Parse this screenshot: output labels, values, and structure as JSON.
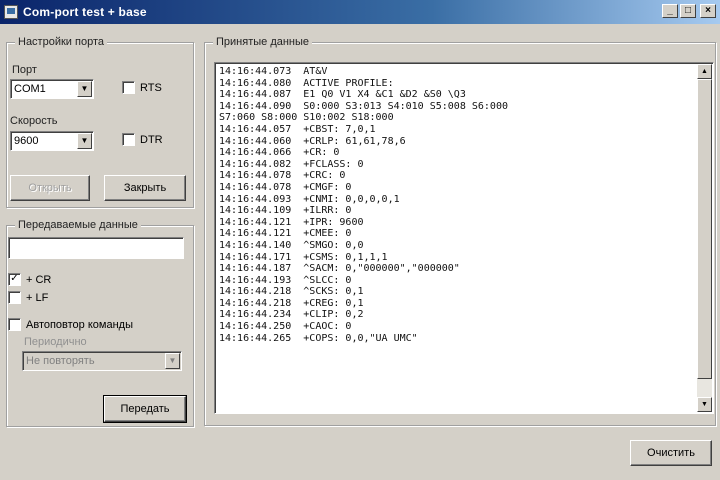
{
  "window": {
    "title": "Com-port test + base",
    "minimize": "_",
    "maximize": "□",
    "close": "×"
  },
  "port_settings": {
    "group_label": "Настройки порта",
    "port_label": "Порт",
    "port_value": "COM1",
    "rts_label": "RTS",
    "speed_label": "Скорость",
    "speed_value": "9600",
    "dtr_label": "DTR",
    "open_button": "Открыть",
    "close_button": "Закрыть"
  },
  "send": {
    "group_label": "Передаваемые данные",
    "input_value": "",
    "cr_label": "+ CR",
    "cr_checked": true,
    "lf_label": "+ LF",
    "lf_checked": false,
    "auto_label": "Автоповтор команды",
    "auto_checked": false,
    "period_label": "Периодично",
    "period_value": "Не повторять",
    "send_button": "Передать"
  },
  "received": {
    "group_label": "Принятые данные",
    "lines": [
      "14:16:44.073  AT&V",
      "14:16:44.080  ACTIVE PROFILE:",
      "14:16:44.087  E1 Q0 V1 X4 &C1 &D2 &S0 \\Q3",
      "14:16:44.090  S0:000 S3:013 S4:010 S5:008 S6:000",
      "S7:060 S8:000 S10:002 S18:000",
      "14:16:44.057  +CBST: 7,0,1",
      "14:16:44.060  +CRLP: 61,61,78,6",
      "14:16:44.066  +CR: 0",
      "14:16:44.082  +FCLASS: 0",
      "14:16:44.078  +CRC: 0",
      "14:16:44.078  +CMGF: 0",
      "14:16:44.093  +CNMI: 0,0,0,0,1",
      "14:16:44.109  +ILRR: 0",
      "14:16:44.121  +IPR: 9600",
      "14:16:44.121  +CMEE: 0",
      "14:16:44.140  ^SMGO: 0,0",
      "14:16:44.171  +CSMS: 0,1,1,1",
      "14:16:44.187  ^SACM: 0,\"000000\",\"000000\"",
      "14:16:44.193  ^SLCC: 0",
      "14:16:44.218  ^SCKS: 0,1",
      "14:16:44.218  +CREG: 0,1",
      "14:16:44.234  +CLIP: 0,2",
      "14:16:44.250  +CAOC: 0",
      "14:16:44.265  +COPS: 0,0,\"UA UMC\""
    ],
    "clear_button": "Очистить"
  },
  "icons": {
    "dropdown": "▼",
    "scroll_up": "▲",
    "scroll_down": "▼",
    "check": "✓"
  }
}
